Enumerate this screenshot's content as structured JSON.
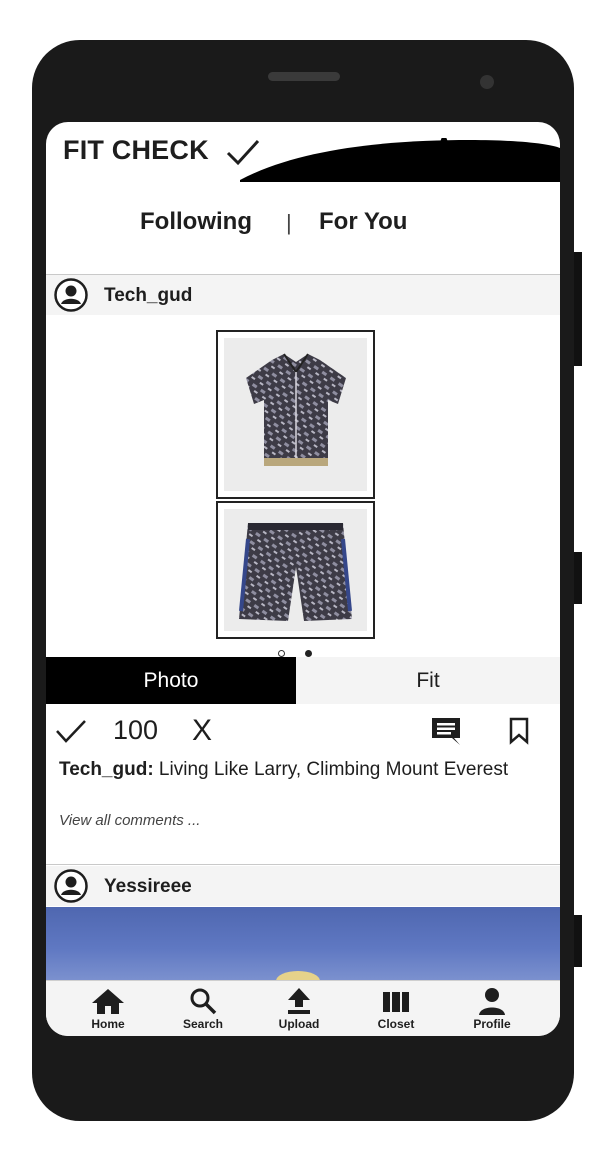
{
  "app": {
    "title": "FIT CHECK"
  },
  "feed_tabs": {
    "following": "Following",
    "separator": "|",
    "for_you": "For You"
  },
  "posts": [
    {
      "username": "Tech_gud",
      "carousel": {
        "total": 2,
        "active": 2
      },
      "toggle": {
        "photo": "Photo",
        "fit": "Fit",
        "selected": "Photo"
      },
      "actions": {
        "likes": "100",
        "dislike_label": "X"
      },
      "caption": {
        "user": "Tech_gud:",
        "text": " Living Like Larry, Climbing Mount Everest"
      },
      "view_comments": "View all comments ..."
    },
    {
      "username": "Yessireee"
    }
  ],
  "nav": {
    "home": "Home",
    "search": "Search",
    "upload": "Upload",
    "closet": "Closet",
    "profile": "Profile"
  },
  "colors": {
    "accent": "#000000",
    "header_bg": "#f4f4f4",
    "phone": "#1a1a1a"
  }
}
